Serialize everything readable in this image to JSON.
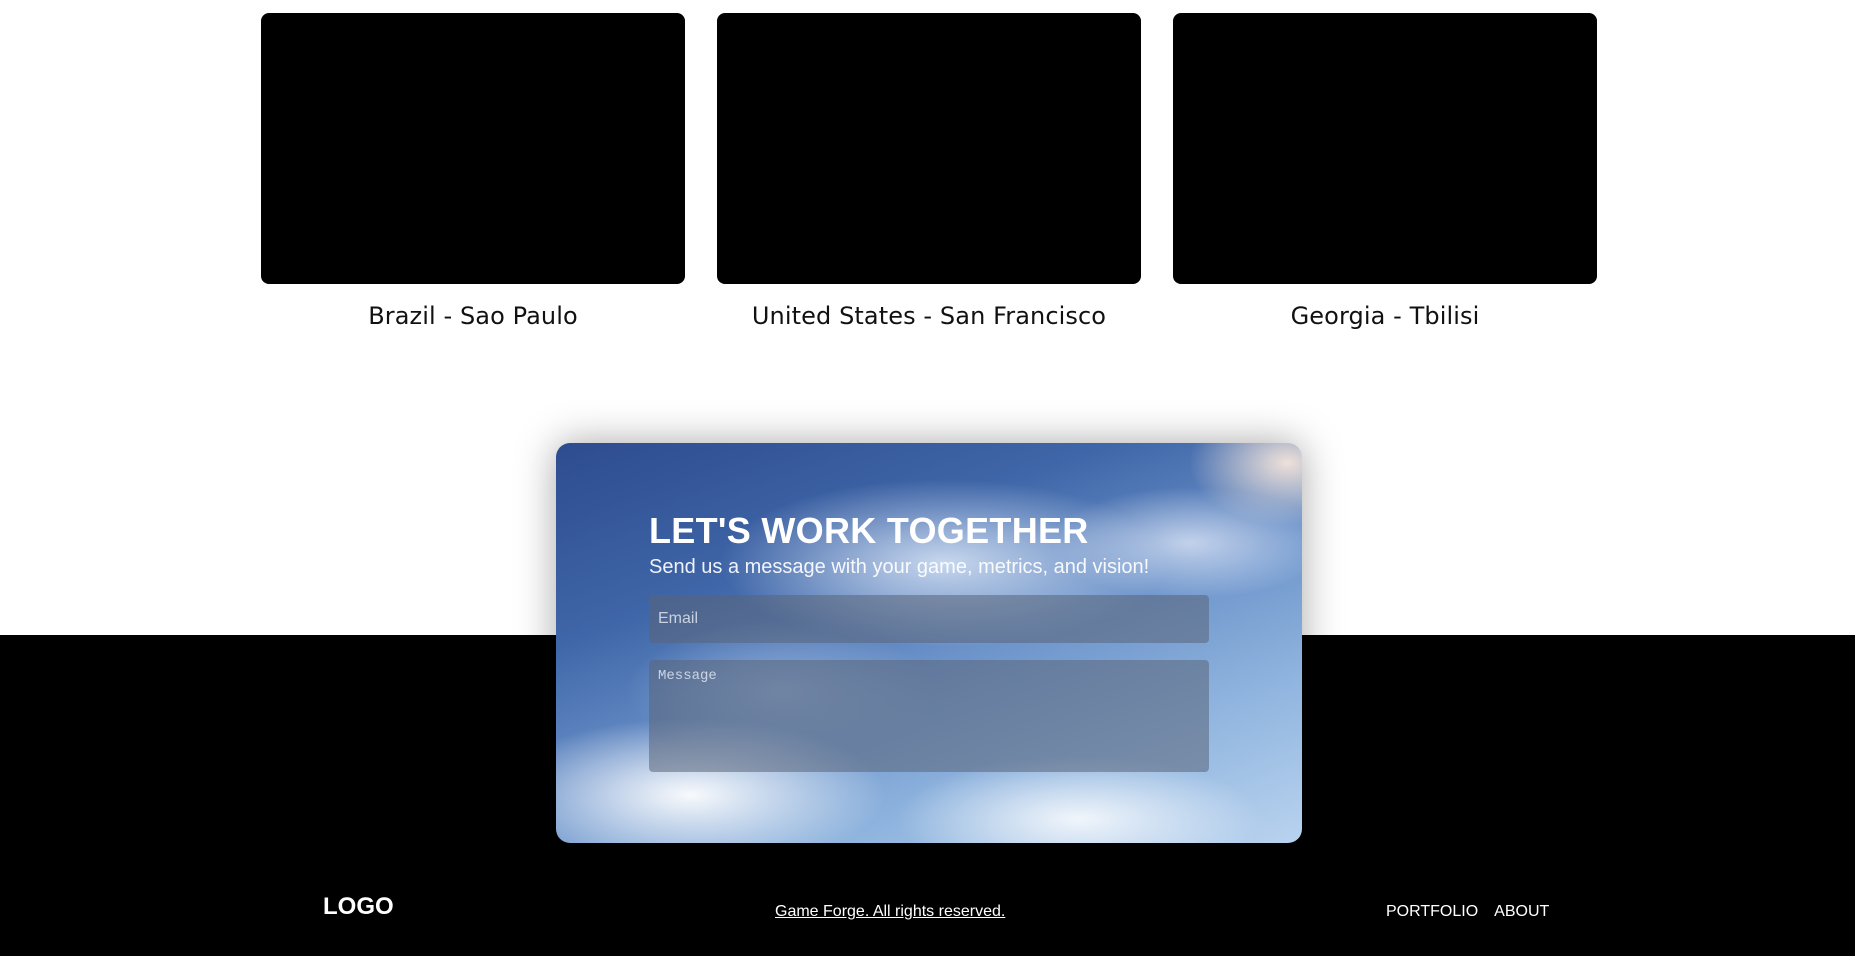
{
  "locations": [
    {
      "caption": "Brazil - Sao Paulo"
    },
    {
      "caption": "United States - San Francisco"
    },
    {
      "caption": "Georgia - Tbilisi"
    }
  ],
  "contact": {
    "title": "LET'S WORK TOGETHER",
    "subtitle": "Send us a message with your game, metrics, and vision!",
    "email_placeholder": "Email",
    "email_value": "",
    "message_placeholder": "Message",
    "message_value": ""
  },
  "footer": {
    "logo": "LOGO",
    "copyright": "Game Forge. All rights reserved.",
    "nav": [
      "PORTFOLIO",
      "ABOUT"
    ]
  },
  "colors": {
    "page_background": "#ffffff",
    "footer_background": "#000000",
    "media_placeholder": "#000000",
    "card_sky_top": "#2d4c8f",
    "card_sky_bottom": "#b9d3ef"
  }
}
